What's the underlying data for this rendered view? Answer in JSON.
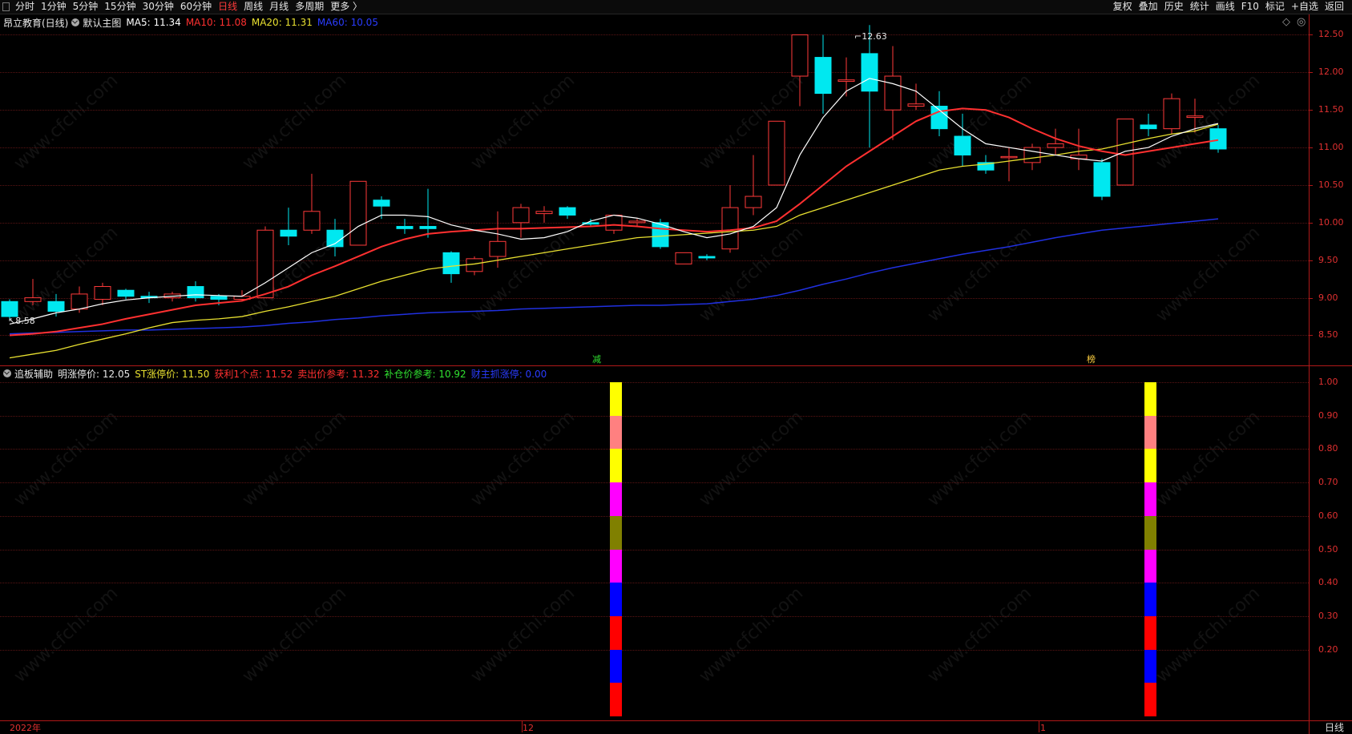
{
  "toolbar": {
    "left_items": [
      "分时",
      "1分钟",
      "5分钟",
      "15分钟",
      "30分钟",
      "60分钟",
      "日线",
      "周线",
      "月线",
      "多周期",
      "更多 〉"
    ],
    "active_item": "日线",
    "right_items": [
      "复权",
      "叠加",
      "历史",
      "统计",
      "画线",
      "F10",
      "标记",
      "+自选",
      "返回"
    ]
  },
  "main_panel": {
    "stock_title": "昂立教育(日线)",
    "template_name": "默认主图",
    "ma": [
      {
        "label": "MA5: 11.34",
        "color": "#ffffff"
      },
      {
        "label": "MA10: 11.08",
        "color": "#ff3030"
      },
      {
        "label": "MA20: 11.31",
        "color": "#e8e030"
      },
      {
        "label": "MA60: 10.05",
        "color": "#2030e0"
      }
    ],
    "diamond": "◇",
    "circle": "◎"
  },
  "sub_panel": {
    "indicator_name": "追板辅助",
    "fields": [
      {
        "label": "明涨停价: 12.05",
        "color": "#e8e8e8"
      },
      {
        "label": "ST涨停价: 11.50",
        "color": "#e8e030"
      },
      {
        "label": "获利1个点: 11.52",
        "color": "#ff3030"
      },
      {
        "label": "卖出价参考: 11.32",
        "color": "#ff3030"
      },
      {
        "label": "补仓价参考: 10.92",
        "color": "#30e030"
      },
      {
        "label": "财主抓涨停: 0.00",
        "color": "#2040ff"
      }
    ],
    "y_ticks": [
      "1.00",
      "0.90",
      "0.80",
      "0.70",
      "0.60",
      "0.50",
      "0.40",
      "0.30",
      "0.20"
    ],
    "bar_colors": [
      "#ffff00",
      "#ff8080",
      "#ffff00",
      "#ff00ff",
      "#808000",
      "#ff00ff",
      "#0000ff",
      "#ff0000",
      "#0000ff",
      "#ff0000"
    ]
  },
  "price_axis": {
    "ticks": [
      "12.50",
      "12.00",
      "11.50",
      "11.00",
      "10.50",
      "10.00",
      "9.50",
      "9.00",
      "8.50"
    ],
    "range": [
      8.1,
      12.75
    ]
  },
  "annotations": {
    "high_label": "12.63",
    "low_label": "8.58",
    "marker_1": "减",
    "marker_2": "榜"
  },
  "x_axis": {
    "labels": [
      "2022年",
      "12",
      "1"
    ]
  },
  "period_label": "日线",
  "watermark": "www.cfchi.com",
  "chart_data": {
    "type": "candlestick",
    "title": "昂立教育(日线)",
    "ylim": [
      8.1,
      12.75
    ],
    "candles": [
      {
        "o": 8.95,
        "h": 8.98,
        "l": 8.7,
        "c": 8.75
      },
      {
        "o": 8.95,
        "h": 9.25,
        "l": 8.9,
        "c": 9.0
      },
      {
        "o": 8.95,
        "h": 9.05,
        "l": 8.75,
        "c": 8.82
      },
      {
        "o": 8.85,
        "h": 9.15,
        "l": 8.8,
        "c": 9.05
      },
      {
        "o": 8.98,
        "h": 9.2,
        "l": 8.9,
        "c": 9.15
      },
      {
        "o": 9.1,
        "h": 9.12,
        "l": 8.98,
        "c": 9.02
      },
      {
        "o": 9.02,
        "h": 9.08,
        "l": 8.93,
        "c": 9.0
      },
      {
        "o": 9.0,
        "h": 9.08,
        "l": 8.95,
        "c": 9.05
      },
      {
        "o": 9.15,
        "h": 9.22,
        "l": 8.95,
        "c": 9.0
      },
      {
        "o": 9.02,
        "h": 9.05,
        "l": 8.9,
        "c": 8.98
      },
      {
        "o": 8.98,
        "h": 9.1,
        "l": 8.95,
        "c": 9.02
      },
      {
        "o": 9.0,
        "h": 9.95,
        "l": 9.0,
        "c": 9.9
      },
      {
        "o": 9.9,
        "h": 10.2,
        "l": 9.7,
        "c": 9.82
      },
      {
        "o": 9.9,
        "h": 10.65,
        "l": 9.85,
        "c": 10.15
      },
      {
        "o": 9.9,
        "h": 10.05,
        "l": 9.55,
        "c": 9.68
      },
      {
        "o": 9.7,
        "h": 10.55,
        "l": 9.7,
        "c": 10.55
      },
      {
        "o": 10.3,
        "h": 10.35,
        "l": 10.05,
        "c": 10.22
      },
      {
        "o": 9.95,
        "h": 10.05,
        "l": 9.85,
        "c": 9.92
      },
      {
        "o": 9.95,
        "h": 10.45,
        "l": 9.8,
        "c": 9.92
      },
      {
        "o": 9.6,
        "h": 9.62,
        "l": 9.2,
        "c": 9.32
      },
      {
        "o": 9.35,
        "h": 9.55,
        "l": 9.3,
        "c": 9.52
      },
      {
        "o": 9.55,
        "h": 10.15,
        "l": 9.4,
        "c": 9.75
      },
      {
        "o": 10.0,
        "h": 10.25,
        "l": 9.8,
        "c": 10.2
      },
      {
        "o": 10.12,
        "h": 10.22,
        "l": 10.0,
        "c": 10.15
      },
      {
        "o": 10.2,
        "h": 10.22,
        "l": 10.05,
        "c": 10.1
      },
      {
        "o": 10.0,
        "h": 10.05,
        "l": 9.95,
        "c": 9.98
      },
      {
        "o": 9.9,
        "h": 10.1,
        "l": 9.85,
        "c": 10.1
      },
      {
        "o": 10.0,
        "h": 10.05,
        "l": 9.95,
        "c": 10.02
      },
      {
        "o": 10.0,
        "h": 10.05,
        "l": 9.65,
        "c": 9.68
      },
      {
        "o": 9.45,
        "h": 9.6,
        "l": 9.45,
        "c": 9.6
      },
      {
        "o": 9.55,
        "h": 9.58,
        "l": 9.5,
        "c": 9.53
      },
      {
        "o": 9.65,
        "h": 10.5,
        "l": 9.6,
        "c": 10.2
      },
      {
        "o": 10.2,
        "h": 10.9,
        "l": 10.1,
        "c": 10.35
      },
      {
        "o": 10.5,
        "h": 11.35,
        "l": 10.5,
        "c": 11.35
      },
      {
        "o": 11.95,
        "h": 12.5,
        "l": 11.55,
        "c": 12.5
      },
      {
        "o": 12.2,
        "h": 12.5,
        "l": 11.45,
        "c": 11.72
      },
      {
        "o": 11.88,
        "h": 12.2,
        "l": 11.68,
        "c": 11.9
      },
      {
        "o": 12.25,
        "h": 12.63,
        "l": 11.0,
        "c": 11.75
      },
      {
        "o": 11.5,
        "h": 12.35,
        "l": 11.1,
        "c": 11.95
      },
      {
        "o": 11.55,
        "h": 11.85,
        "l": 11.5,
        "c": 11.58
      },
      {
        "o": 11.55,
        "h": 11.75,
        "l": 11.15,
        "c": 11.25
      },
      {
        "o": 11.15,
        "h": 11.45,
        "l": 10.75,
        "c": 10.9
      },
      {
        "o": 10.8,
        "h": 10.9,
        "l": 10.65,
        "c": 10.7
      },
      {
        "o": 10.88,
        "h": 11.0,
        "l": 10.55,
        "c": 10.88
      },
      {
        "o": 10.8,
        "h": 11.05,
        "l": 10.7,
        "c": 11.0
      },
      {
        "o": 11.0,
        "h": 11.25,
        "l": 10.9,
        "c": 11.05
      },
      {
        "o": 10.85,
        "h": 11.25,
        "l": 10.7,
        "c": 10.9
      },
      {
        "o": 10.8,
        "h": 10.85,
        "l": 10.3,
        "c": 10.35
      },
      {
        "o": 10.5,
        "h": 11.38,
        "l": 10.5,
        "c": 11.38
      },
      {
        "o": 11.3,
        "h": 11.45,
        "l": 11.15,
        "c": 11.25
      },
      {
        "o": 11.25,
        "h": 11.72,
        "l": 11.18,
        "c": 11.65
      },
      {
        "o": 11.4,
        "h": 11.65,
        "l": 11.2,
        "c": 11.42
      },
      {
        "o": 11.25,
        "h": 11.3,
        "l": 10.93,
        "c": 10.98
      }
    ],
    "ma5": [
      8.65,
      8.72,
      8.8,
      8.85,
      8.92,
      8.97,
      9.0,
      9.02,
      9.04,
      9.03,
      9.02,
      9.2,
      9.4,
      9.6,
      9.72,
      9.95,
      10.1,
      10.1,
      10.08,
      9.97,
      9.9,
      9.85,
      9.78,
      9.8,
      9.88,
      10.02,
      10.1,
      10.06,
      9.98,
      9.88,
      9.8,
      9.85,
      9.95,
      10.2,
      10.9,
      11.4,
      11.75,
      11.92,
      11.85,
      11.75,
      11.5,
      11.25,
      11.05,
      11.0,
      10.95,
      10.9,
      10.85,
      10.82,
      10.95,
      11.0,
      11.15,
      11.25,
      11.32
    ],
    "ma10": [
      8.5,
      8.52,
      8.55,
      8.6,
      8.65,
      8.72,
      8.78,
      8.84,
      8.9,
      8.93,
      8.96,
      9.05,
      9.15,
      9.3,
      9.42,
      9.55,
      9.68,
      9.78,
      9.85,
      9.88,
      9.9,
      9.92,
      9.92,
      9.93,
      9.94,
      9.95,
      9.97,
      9.95,
      9.92,
      9.9,
      9.88,
      9.9,
      9.93,
      10.02,
      10.25,
      10.5,
      10.75,
      10.95,
      11.15,
      11.35,
      11.48,
      11.52,
      11.5,
      11.4,
      11.25,
      11.12,
      11.02,
      10.95,
      10.9,
      10.95,
      11.0,
      11.05,
      11.1
    ],
    "ma20": [
      8.2,
      8.25,
      8.3,
      8.38,
      8.45,
      8.52,
      8.6,
      8.67,
      8.7,
      8.72,
      8.75,
      8.82,
      8.88,
      8.95,
      9.02,
      9.12,
      9.22,
      9.3,
      9.38,
      9.42,
      9.45,
      9.5,
      9.55,
      9.6,
      9.65,
      9.7,
      9.75,
      9.8,
      9.82,
      9.84,
      9.86,
      9.88,
      9.9,
      9.95,
      10.1,
      10.2,
      10.3,
      10.4,
      10.5,
      10.6,
      10.7,
      10.75,
      10.78,
      10.82,
      10.86,
      10.9,
      10.95,
      10.98,
      11.05,
      11.12,
      11.18,
      11.22,
      11.31
    ],
    "ma60": [
      8.52,
      8.53,
      8.54,
      8.55,
      8.56,
      8.57,
      8.57,
      8.58,
      8.59,
      8.6,
      8.61,
      8.63,
      8.66,
      8.68,
      8.71,
      8.73,
      8.76,
      8.78,
      8.8,
      8.81,
      8.82,
      8.83,
      8.85,
      8.86,
      8.87,
      8.88,
      8.89,
      8.9,
      8.9,
      8.91,
      8.92,
      8.95,
      8.98,
      9.03,
      9.1,
      9.18,
      9.25,
      9.33,
      9.4,
      9.46,
      9.52,
      9.58,
      9.63,
      9.68,
      9.74,
      9.8,
      9.85,
      9.9,
      9.93,
      9.96,
      9.99,
      10.02,
      10.05
    ],
    "indicator_bars_at_candle": [
      26,
      49
    ]
  }
}
